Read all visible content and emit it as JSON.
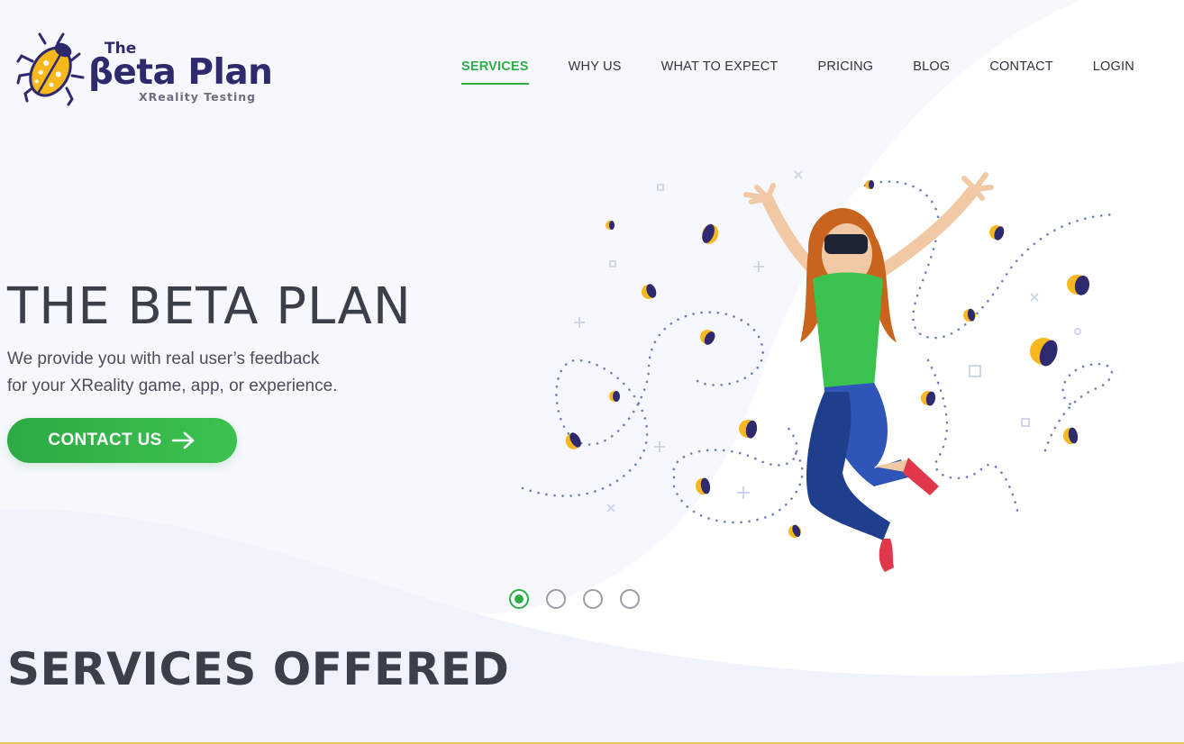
{
  "brand": {
    "the": "The",
    "name": "βeta Plan",
    "tagline": "XReality Testing"
  },
  "nav": {
    "items": [
      {
        "label": "SERVICES",
        "active": true
      },
      {
        "label": "WHY US",
        "active": false
      },
      {
        "label": "WHAT TO EXPECT",
        "active": false
      },
      {
        "label": "PRICING",
        "active": false
      },
      {
        "label": "BLOG",
        "active": false
      },
      {
        "label": "CONTACT",
        "active": false
      },
      {
        "label": "LOGIN",
        "active": false
      }
    ]
  },
  "hero": {
    "title": "THE BETA PLAN",
    "description_line1": "We provide you with real user’s feedback",
    "description_line2": "for your XReality game, app, or experience.",
    "cta_label": "CONTACT US",
    "cta_icon": "arrow-right-icon"
  },
  "slider": {
    "count": 4,
    "active_index": 0
  },
  "services": {
    "title": "SERVICES OFFERED"
  },
  "colors": {
    "accent_green": "#2fae47",
    "brand_navy": "#2d2a6e",
    "bug_yellow": "#f7b81e",
    "text_dark": "#3a3f4a"
  }
}
